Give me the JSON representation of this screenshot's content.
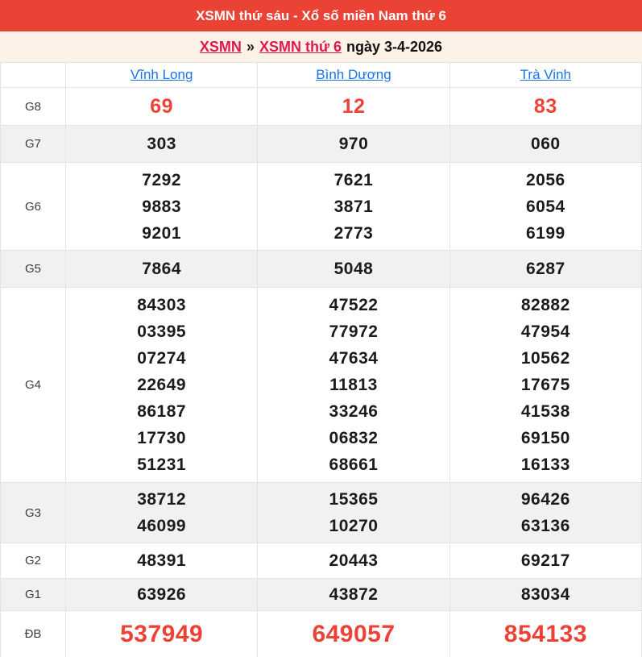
{
  "header": {
    "title": "XSMN thứ sáu - Xổ số miền Nam thứ 6"
  },
  "breadcrumb": {
    "links": [
      {
        "label": "XSMN"
      },
      {
        "label": "XSMN thứ 6"
      }
    ],
    "separator": "»",
    "date_text": "ngày 3-4-2026"
  },
  "table": {
    "provinces": [
      "Vĩnh Long",
      "Bình Dương",
      "Trà Vinh"
    ],
    "rows": [
      {
        "label": "G8",
        "style": "red-large",
        "values": [
          [
            "69"
          ],
          [
            "12"
          ],
          [
            "83"
          ]
        ]
      },
      {
        "label": "G7",
        "values": [
          [
            "303"
          ],
          [
            "970"
          ],
          [
            "060"
          ]
        ]
      },
      {
        "label": "G6",
        "values": [
          [
            "7292",
            "9883",
            "9201"
          ],
          [
            "7621",
            "3871",
            "2773"
          ],
          [
            "2056",
            "6054",
            "6199"
          ]
        ]
      },
      {
        "label": "G5",
        "values": [
          [
            "7864"
          ],
          [
            "5048"
          ],
          [
            "6287"
          ]
        ]
      },
      {
        "label": "G4",
        "values": [
          [
            "84303",
            "03395",
            "07274",
            "22649",
            "86187",
            "17730",
            "51231"
          ],
          [
            "47522",
            "77972",
            "47634",
            "11813",
            "33246",
            "06832",
            "68661"
          ],
          [
            "82882",
            "47954",
            "10562",
            "17675",
            "41538",
            "69150",
            "16133"
          ]
        ]
      },
      {
        "label": "G3",
        "values": [
          [
            "38712",
            "46099"
          ],
          [
            "15365",
            "10270"
          ],
          [
            "96426",
            "63136"
          ]
        ]
      },
      {
        "label": "G2",
        "values": [
          [
            "48391"
          ],
          [
            "20443"
          ],
          [
            "69217"
          ]
        ]
      },
      {
        "label": "G1",
        "values": [
          [
            "63926"
          ],
          [
            "43872"
          ],
          [
            "83034"
          ]
        ]
      },
      {
        "label": "ĐB",
        "style": "red-xlarge",
        "values": [
          [
            "537949"
          ],
          [
            "649057"
          ],
          [
            "854133"
          ]
        ]
      }
    ]
  },
  "colors": {
    "header_bg": "#EA4335",
    "header_text": "#FFFFFF",
    "breadcrumb_bg": "#FDF2E8",
    "link_red": "#E0194D",
    "link_blue": "#1A73E8",
    "number_red": "#EE4237",
    "number_black": "#1B1B1B",
    "row_shade": "#F1F1F1",
    "border": "#E3E3E3"
  }
}
